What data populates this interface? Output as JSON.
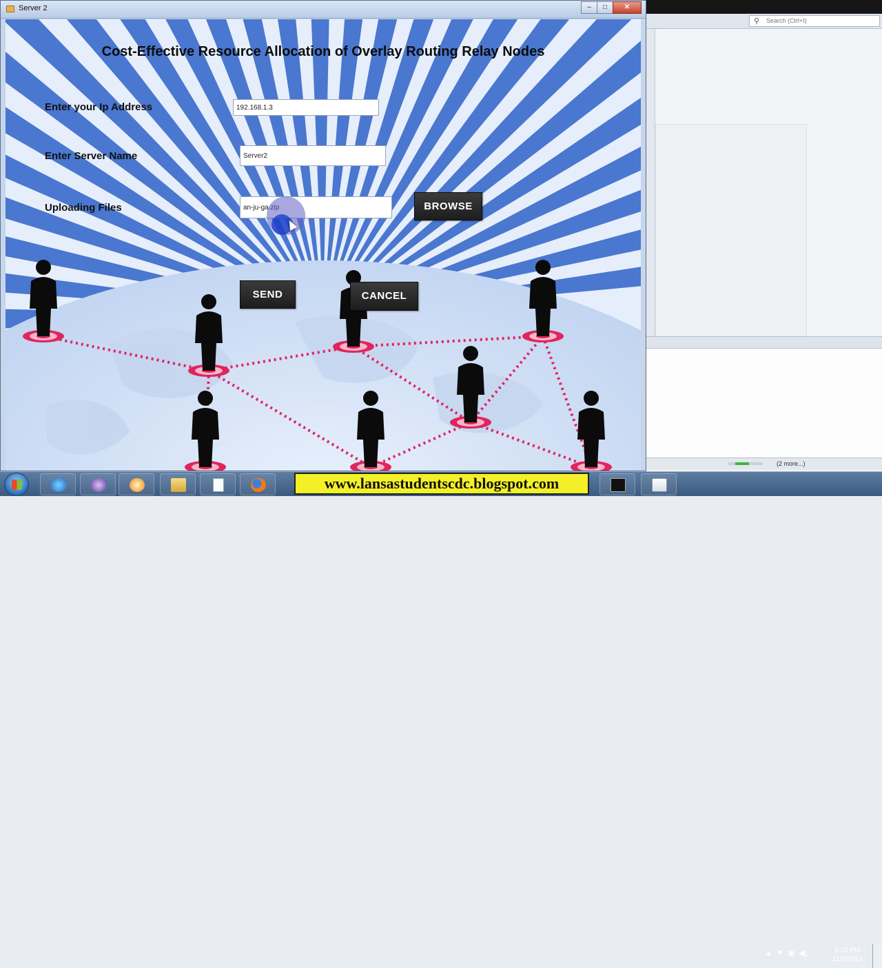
{
  "window": {
    "title": "Server 2",
    "min_glyph": "–",
    "max_glyph": "□",
    "close_glyph": "✕"
  },
  "app": {
    "heading": "Cost-Effective Resource Allocation of Overlay Routing Relay Nodes"
  },
  "form": {
    "ip_label": "Enter your Ip Address",
    "ip_value": "192.168.1.3",
    "server_label": "Enter Server Name",
    "server_value": "Server2",
    "upload_label": "Uploading Files",
    "upload_value": "an-ju-ga.zip",
    "browse_label": "BROWSE",
    "send_label": "SEND",
    "cancel_label": "CANCEL"
  },
  "background_ide": {
    "search_placeholder": "Search (Ctrl+I)",
    "status_more": "(2 more...)"
  },
  "taskbar": {
    "banner": "www.lansastudentscdc.blogspot.com",
    "time": "9:26 PM",
    "date": "11/3/2014"
  },
  "colors": {
    "ray_blue": "#2f63c8",
    "node_red": "#e0245e",
    "button_dark": "#242424",
    "banner_yellow": "#f3f028"
  }
}
